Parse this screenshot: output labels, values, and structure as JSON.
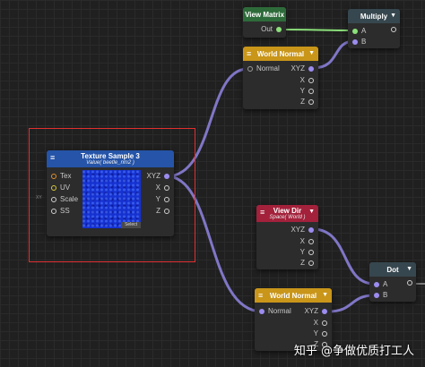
{
  "nodes": {
    "view_matrix": {
      "title": "View Matrix",
      "header_color": "#2e6b3a",
      "output": "Out"
    },
    "multiply": {
      "title": "Multiply",
      "header_color": "#37474f",
      "inputs": [
        "A",
        "B"
      ]
    },
    "world_normal_top": {
      "title": "World Normal",
      "header_color": "#c9961a",
      "input": "Normal",
      "outputs": [
        "XYZ",
        "X",
        "Y",
        "Z"
      ]
    },
    "texture_sample": {
      "title": "Texture Sample 3",
      "subtitle": "Value( beetle_nm2 )",
      "header_color": "#2554a8",
      "inputs": [
        "Tex",
        "UV",
        "Scale",
        "SS"
      ],
      "scale_hint": "XY",
      "outputs": [
        "XYZ",
        "X",
        "Y",
        "Z"
      ],
      "select_label": "Select"
    },
    "view_dir": {
      "title": "View Dir",
      "subtitle": "Space( World )",
      "header_color": "#a3213b",
      "outputs": [
        "XYZ",
        "X",
        "Y",
        "Z"
      ]
    },
    "dot": {
      "title": "Dot",
      "header_color": "#37474f",
      "inputs": [
        "A",
        "B"
      ]
    },
    "world_normal_bottom": {
      "title": "World Normal",
      "header_color": "#c9961a",
      "input": "Normal",
      "outputs": [
        "XYZ",
        "X",
        "Y",
        "Z"
      ]
    }
  },
  "wire_color": "#8a7fd8",
  "wire_color_matrix": "#8be07a",
  "watermark": "知乎 @争做优质打工人"
}
